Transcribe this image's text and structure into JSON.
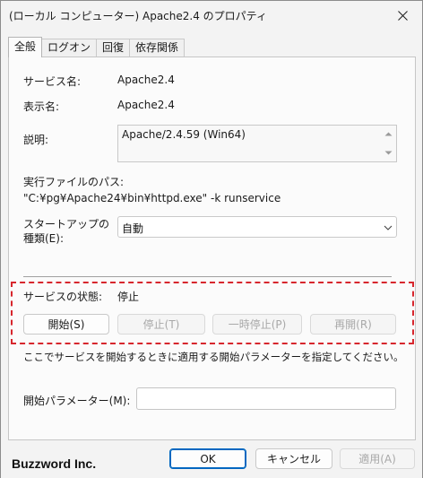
{
  "window": {
    "title": "(ローカル コンピューター) Apache2.4 のプロパティ"
  },
  "tabs": [
    {
      "label": "全般",
      "active": true
    },
    {
      "label": "ログオン",
      "active": false
    },
    {
      "label": "回復",
      "active": false
    },
    {
      "label": "依存関係",
      "active": false
    }
  ],
  "general": {
    "service_name_label": "サービス名:",
    "service_name_value": "Apache2.4",
    "display_name_label": "表示名:",
    "display_name_value": "Apache2.4",
    "description_label": "説明:",
    "description_value": "Apache/2.4.59 (Win64)",
    "exe_path_label": "実行ファイルのパス:",
    "exe_path_value": "\"C:¥pg¥Apache24¥bin¥httpd.exe\" -k runservice",
    "startup_type_label_line1": "スタートアップの",
    "startup_type_label_line2": "種類(E):",
    "startup_type_value": "自動",
    "status_label": "サービスの状態:",
    "status_value": "停止",
    "start_button": "開始(S)",
    "stop_button": "停止(T)",
    "pause_button": "一時停止(P)",
    "resume_button": "再開(R)",
    "hint_text": "ここでサービスを開始するときに適用する開始パラメーターを指定してください。",
    "start_params_label": "開始パラメーター(M):",
    "start_params_value": ""
  },
  "footer": {
    "brand": "Buzzword Inc.",
    "ok_button": "OK",
    "cancel_button": "キャンセル",
    "apply_button": "適用(A)"
  },
  "colors": {
    "highlight_border": "#d7262d",
    "primary_button_border": "#0067c0"
  }
}
